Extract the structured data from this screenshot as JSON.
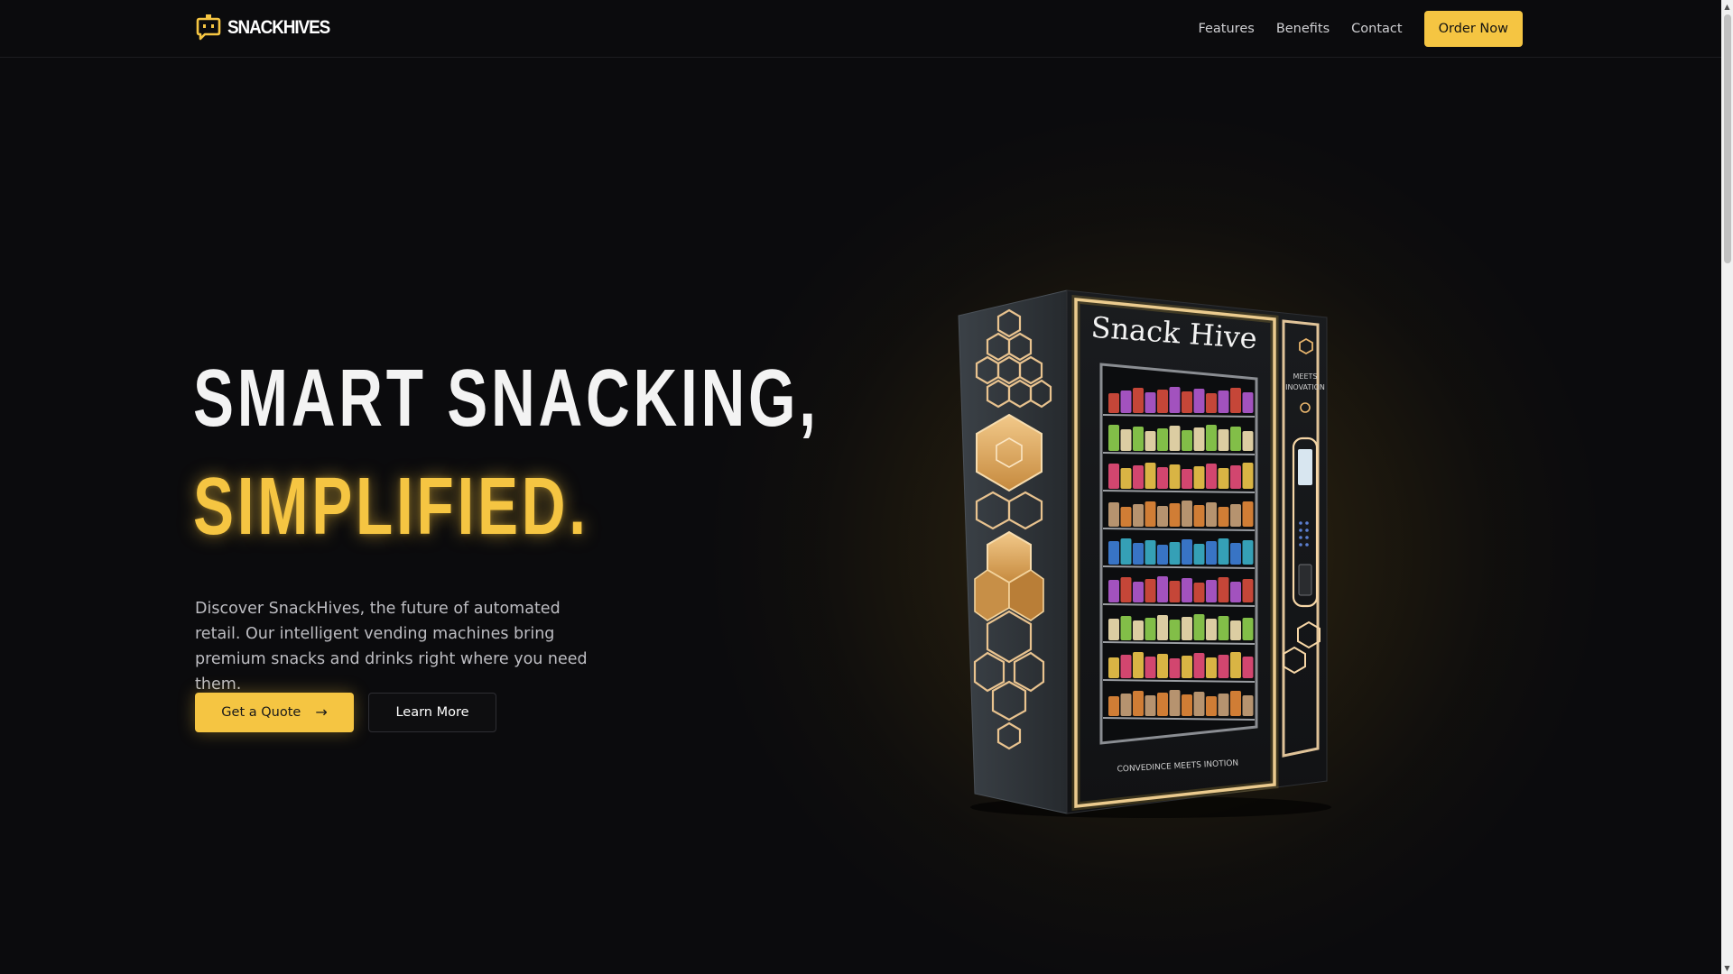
{
  "brand": {
    "name": "SNACKHIVES",
    "icon": "chat-bubble-logo-icon",
    "accent_color": "#f5c542"
  },
  "nav": {
    "links": [
      "Features",
      "Benefits",
      "Contact"
    ],
    "order_label": "Order Now"
  },
  "hero": {
    "title_line1": "SMART SNACKING,",
    "title_line2": "SIMPLIFIED.",
    "description": "Discover SnackHives, the future of automated retail. Our intelligent vending machines bring premium snacks and drinks right where you need them.",
    "primary_cta": "Get a Quote",
    "primary_cta_icon": "arrow-right-icon",
    "secondary_cta": "Learn More"
  },
  "machine": {
    "title": "Snack Hive",
    "side_text_line1": "MEETS",
    "side_text_line2": "INOVATION",
    "bottom_text": "CONVEDINCE MEETS INOTION"
  }
}
